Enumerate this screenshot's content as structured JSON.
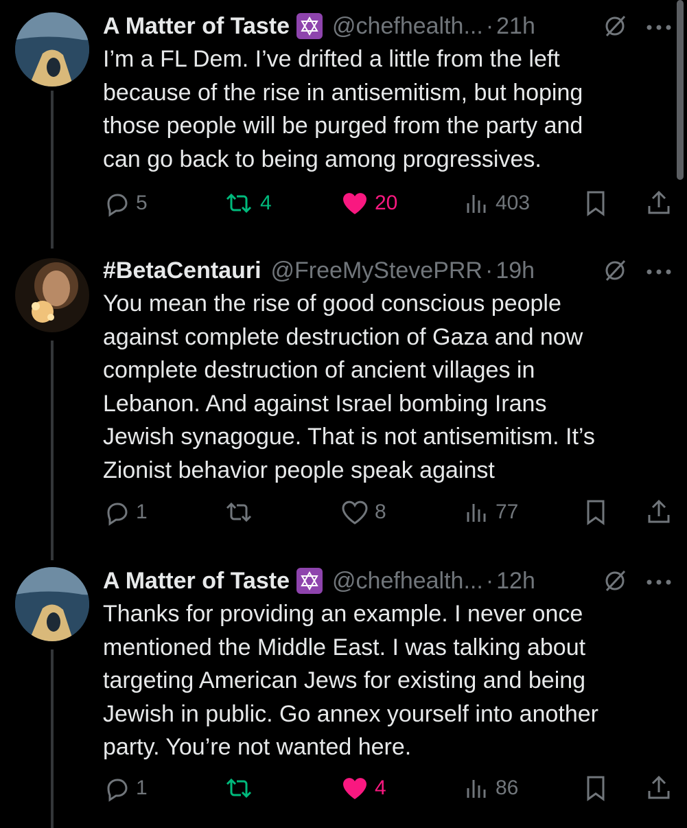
{
  "tweets": [
    {
      "name": "A Matter of Taste",
      "badge": "✡",
      "handle": "@chefhealth...",
      "separator": "·",
      "time": "21h",
      "text": "I’m a FL Dem. I’ve drifted a little from the left\nbecause of the rise in antisemitism, but hoping\nthose people will be purged from the party and\ncan go back to being among progressives.",
      "replies": "5",
      "reposts": "4",
      "likes": "20",
      "views": "403",
      "reposted": true,
      "liked": true
    },
    {
      "name": "#BetaCentauri",
      "badge": "",
      "handle": "@FreeMyStevePRR",
      "separator": "·",
      "time": "19h",
      "text": "You mean the rise of good conscious people\nagainst complete destruction of Gaza and now\ncomplete destruction of ancient villages in\nLebanon. And against Israel bombing Irans\nJewish synagogue. That is not antisemitism. It’s\nZionist behavior people speak against",
      "replies": "1",
      "reposts": "",
      "likes": "8",
      "views": "77",
      "reposted": false,
      "liked": false
    },
    {
      "name": "A Matter of Taste",
      "badge": "✡",
      "handle": "@chefhealth...",
      "separator": "·",
      "time": "12h",
      "text": "Thanks for providing an example. I never once\nmentioned the Middle East. I was talking about\ntargeting American Jews for existing and being\nJewish in public. Go annex yourself into another\nparty. You’re not wanted here.",
      "replies": "1",
      "reposts": "",
      "likes": "4",
      "views": "86",
      "reposted": true,
      "liked": true
    }
  ],
  "colors": {
    "background": "#000000",
    "text": "#e7e9ea",
    "muted": "#71767b",
    "repost_active": "#00ba7c",
    "like_active": "#f91880",
    "badge": "#8e44ad"
  },
  "icons": [
    "reply-icon",
    "repost-icon",
    "like-icon",
    "views-icon",
    "bookmark-icon",
    "share-icon",
    "grok-icon",
    "more-icon"
  ]
}
